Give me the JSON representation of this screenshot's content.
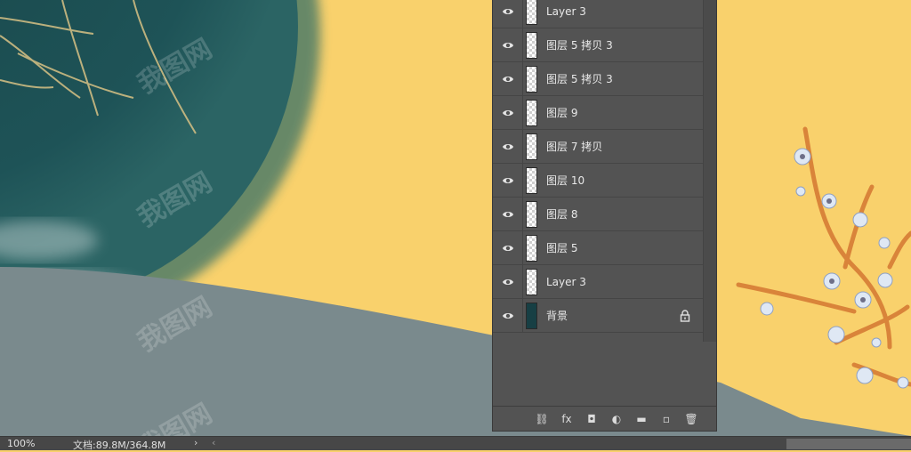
{
  "layers": [
    {
      "name": "Layer 3",
      "thumb": "transparent",
      "locked": false
    },
    {
      "name": "图层 5 拷贝 3",
      "thumb": "transparent",
      "locked": false
    },
    {
      "name": "图层 5 拷贝 3",
      "thumb": "transparent",
      "locked": false
    },
    {
      "name": "图层 9",
      "thumb": "transparent",
      "locked": false
    },
    {
      "name": "图层 7 拷贝",
      "thumb": "transparent",
      "locked": false
    },
    {
      "name": "图层 10",
      "thumb": "transparent",
      "locked": false
    },
    {
      "name": "图层 8",
      "thumb": "transparent",
      "locked": false
    },
    {
      "name": "图层 5",
      "thumb": "transparent",
      "locked": false
    },
    {
      "name": "Layer 3",
      "thumb": "transparent",
      "locked": false
    },
    {
      "name": "背景",
      "thumb": "dark",
      "locked": true
    }
  ],
  "panel_tools": [
    {
      "name": "link-layers-icon",
      "glyph": "⛓"
    },
    {
      "name": "fx-icon",
      "glyph": "fx"
    },
    {
      "name": "add-mask-icon",
      "glyph": "◘"
    },
    {
      "name": "adjustment-layer-icon",
      "glyph": "◐"
    },
    {
      "name": "new-group-icon",
      "glyph": "▬"
    },
    {
      "name": "new-layer-icon",
      "glyph": "▫"
    },
    {
      "name": "delete-layer-icon",
      "glyph": "🗑"
    }
  ],
  "status": {
    "zoom": "100%",
    "doc": "文档:89.8M/364.8M",
    "arrow": "›",
    "left_arrow": "‹"
  },
  "colors": {
    "background": "#f9d16c",
    "moon_dark": "#1c5053",
    "ground": "#7a8a8d",
    "panel": "#535353",
    "statusbar": "#474747"
  },
  "watermark": "我图网"
}
